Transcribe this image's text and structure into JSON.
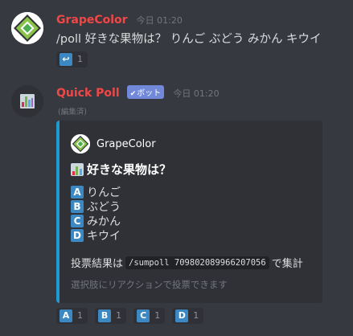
{
  "message1": {
    "username": "GrapeColor",
    "timestamp": "今日 01:20",
    "content": "/poll 好きな果物は？ りんご ぶどう みかん キウイ",
    "reactions": [
      {
        "emoji": "↩",
        "count": "1"
      }
    ]
  },
  "message2": {
    "username": "Quick Poll",
    "bot_badge": "ボット",
    "timestamp": "今日 01:20",
    "edited": "(編集済)",
    "embed": {
      "author": "GrapeColor",
      "title": "好きな果物は？",
      "options": [
        {
          "letter": "A",
          "text": "りんご"
        },
        {
          "letter": "B",
          "text": "ぶどう"
        },
        {
          "letter": "C",
          "text": "みかん"
        },
        {
          "letter": "D",
          "text": "キウイ"
        }
      ],
      "result_prefix": "投票結果は",
      "result_code": "/sumpoll 709802089966207056",
      "result_suffix": "で集計",
      "footer": "選択肢にリアクションで投票できます",
      "accent_color": "#1d9bd1"
    },
    "reactions": [
      {
        "emoji": "A",
        "count": "1"
      },
      {
        "emoji": "B",
        "count": "1"
      },
      {
        "emoji": "C",
        "count": "1"
      },
      {
        "emoji": "D",
        "count": "1"
      }
    ]
  },
  "colors": {
    "background": "#36393f",
    "username": "#f04747",
    "regional_indicator": "#3b88c3",
    "bot_badge": "#7289da"
  },
  "icons": {
    "grape_avatar": "grapecolor-logo-icon",
    "poll_avatar": "bar-chart-icon",
    "reaction_return": "return-arrow-icon"
  }
}
